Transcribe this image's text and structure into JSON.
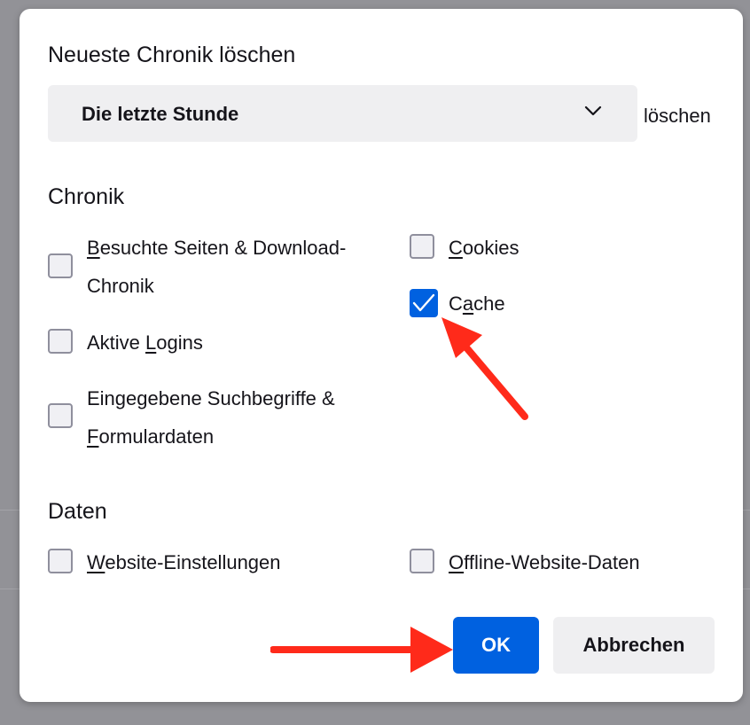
{
  "dialog": {
    "title": "Neueste Chronik löschen",
    "time_range": {
      "selected": "Die letzte Stunde",
      "suffix": "löschen"
    },
    "history_section": {
      "heading": "Chronik",
      "items": [
        {
          "pre": "",
          "key": "B",
          "rest": "esuchte Seiten & Download-",
          "line2": "Chronik",
          "checked": false
        },
        {
          "pre": "Aktive ",
          "key": "L",
          "rest": "ogins",
          "checked": false
        },
        {
          "pre": "Eingegebene Suchbegriffe &",
          "key": "F",
          "rest": "ormulardaten",
          "checked": false
        },
        {
          "pre": "",
          "key": "C",
          "rest": "ookies",
          "checked": false
        },
        {
          "pre": "C",
          "key": "a",
          "rest": "che",
          "checked": true
        }
      ]
    },
    "data_section": {
      "heading": "Daten",
      "items": [
        {
          "pre": "",
          "key": "W",
          "rest": "ebsite-Einstellungen",
          "checked": false
        },
        {
          "pre": "",
          "key": "O",
          "rest": "ffline-Website-Daten",
          "checked": false
        }
      ]
    },
    "buttons": {
      "ok": "OK",
      "cancel": "Abbrechen"
    }
  },
  "colors": {
    "accent": "#0061e0",
    "annotation_arrow": "#ff2a1a"
  },
  "icons": {
    "dropdown": "chevron-down-icon",
    "check": "checkmark-icon"
  }
}
